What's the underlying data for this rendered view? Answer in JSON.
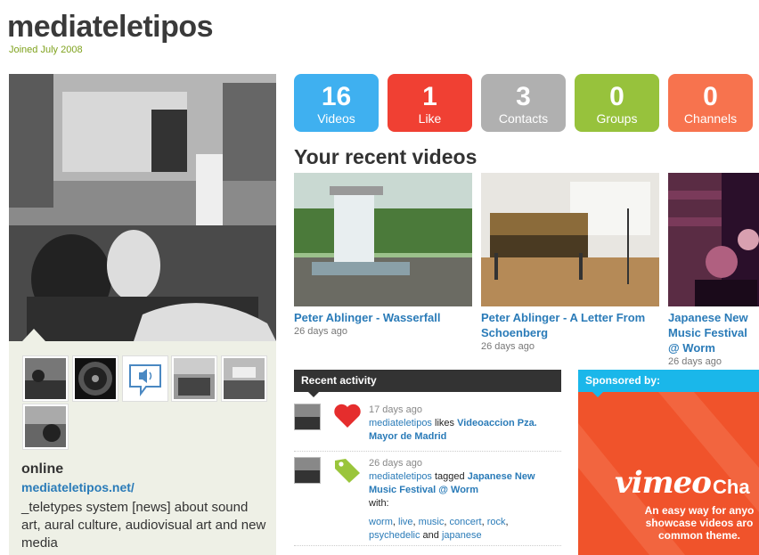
{
  "profile": {
    "username": "mediateletipos",
    "joined": "Joined July 2008",
    "status": "online",
    "link": "mediateletipos.net/",
    "bio": "_teletypes system [news] about sound art, aural culture, audiovisual art and new media"
  },
  "stats": [
    {
      "count": "16",
      "label": "Videos",
      "color": "#3fb0f0"
    },
    {
      "count": "1",
      "label": "Like",
      "color": "#f04033"
    },
    {
      "count": "3",
      "label": "Contacts",
      "color": "#b0b0b0"
    },
    {
      "count": "0",
      "label": "Groups",
      "color": "#97c23c"
    },
    {
      "count": "0",
      "label": "Channels",
      "color": "#f7734e"
    }
  ],
  "recent_videos": {
    "title": "Your recent videos",
    "items": [
      {
        "title": "Peter Ablinger - Wasserfall",
        "age": "26 days ago"
      },
      {
        "title": "Peter Ablinger - A Letter From Schoenberg",
        "age": "26 days ago"
      },
      {
        "title": "Japanese New Music Festival @ Worm",
        "age": "26 days ago"
      }
    ]
  },
  "activity": {
    "header": "Recent activity",
    "items": [
      {
        "when": "17 days ago",
        "user": "mediateletipos",
        "verb": "likes",
        "object": "Videoaccion Pza. Mayor de Madrid",
        "icon": "heart-icon"
      },
      {
        "when": "26 days ago",
        "user": "mediateletipos",
        "verb": "tagged",
        "object": "Japanese New Music Festival @ Worm",
        "with": "with:",
        "tags": [
          "worm",
          "live",
          "music",
          "concert",
          "rock",
          "psychedelic"
        ],
        "and": "and",
        "last_tag": "japanese",
        "icon": "tag-icon"
      }
    ]
  },
  "sponsor": {
    "header": "Sponsored by:",
    "logo": "vimeo",
    "logo_suffix": "Cha",
    "copy": "An easy way for anyo showcase videos aro common theme."
  },
  "colors": {
    "link": "#2a7bb8",
    "accent_green": "#7fa21d",
    "sponsor_bg": "#f0532b",
    "sponsor_header": "#1ab7ea"
  }
}
